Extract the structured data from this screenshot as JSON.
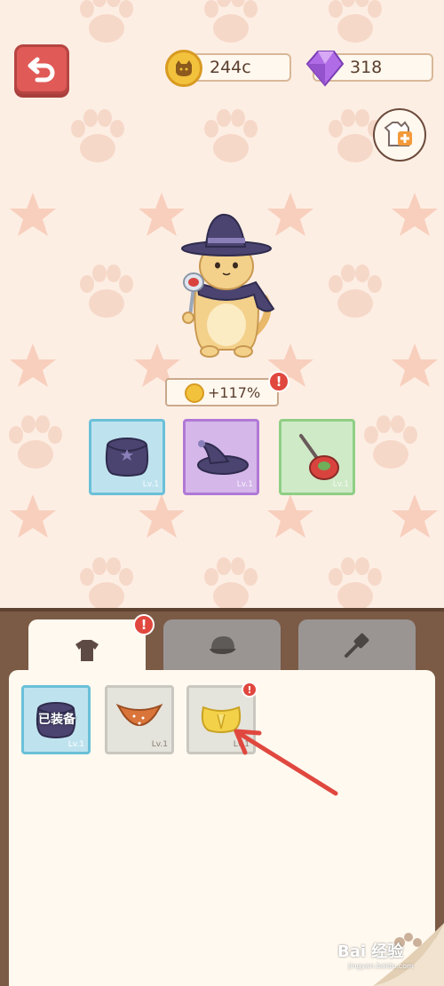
{
  "header": {
    "coins": "244c",
    "gems": "318"
  },
  "bonus": {
    "text": "+117%",
    "alert": "!"
  },
  "equipped_slots": [
    {
      "name": "cape",
      "level": "Lv.1"
    },
    {
      "name": "witch-hat",
      "level": "Lv.1"
    },
    {
      "name": "strawberry-spoon",
      "level": "Lv.1"
    }
  ],
  "tabs": {
    "clothes_alert": "!"
  },
  "inventory": {
    "items": [
      {
        "name": "purple-cape",
        "level": "Lv.1",
        "status": "已装备"
      },
      {
        "name": "orange-scarf",
        "level": "Lv.1"
      },
      {
        "name": "yellow-cape",
        "level": "Lv.1",
        "alert": "!"
      }
    ]
  },
  "watermark": {
    "brand": "Bai 经验",
    "url": "jingyan.baidu.com"
  },
  "colors": {
    "background": "#fdeee4",
    "accent_red": "#e05a57",
    "panel_brown": "#7b5a46"
  }
}
